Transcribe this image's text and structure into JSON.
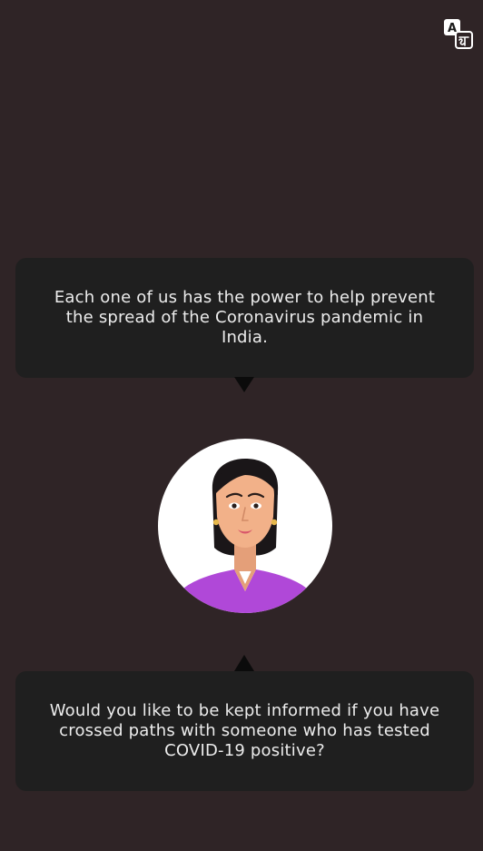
{
  "header": {
    "language_toggle_icon": "translate-icon"
  },
  "messages": [
    {
      "text": "Each one of us has the power to help prevent the spread of the Coronavirus pandemic in India."
    },
    {
      "text": "Would you like to be kept informed if you have crossed paths with someone who has tested COVID-19 positive?"
    }
  ],
  "avatar": {
    "icon": "assistant-avatar-icon"
  },
  "colors": {
    "background": "#2f2426",
    "bubble": "#1f1f1f",
    "bubble_text": "#ececec",
    "pointer": "#0b0b0b",
    "avatar_circle": "#ffffff",
    "shirt": "#b048d8",
    "skin": "#f2b189"
  }
}
